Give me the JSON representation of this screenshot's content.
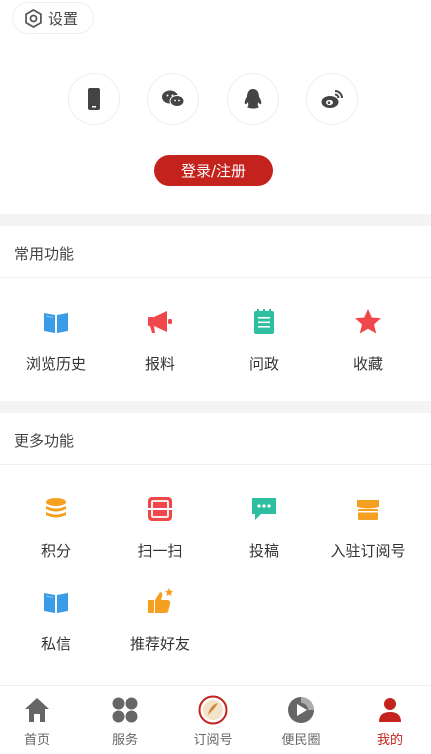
{
  "header": {
    "settings_label": "设置"
  },
  "social_logins": [
    {
      "name": "phone-icon"
    },
    {
      "name": "wechat-icon"
    },
    {
      "name": "qq-icon"
    },
    {
      "name": "weibo-icon"
    }
  ],
  "login_button_label": "登录/注册",
  "common_functions": {
    "title": "常用功能",
    "items": [
      {
        "label": "浏览历史",
        "icon": "book-icon"
      },
      {
        "label": "报料",
        "icon": "megaphone-icon"
      },
      {
        "label": "问政",
        "icon": "notepad-icon"
      },
      {
        "label": "收藏",
        "icon": "star-icon"
      }
    ]
  },
  "more_functions": {
    "title": "更多功能",
    "items": [
      {
        "label": "积分",
        "icon": "coins-icon"
      },
      {
        "label": "扫一扫",
        "icon": "scan-icon"
      },
      {
        "label": "投稿",
        "icon": "chat-bubble-icon"
      },
      {
        "label": "入驻订阅号",
        "icon": "store-icon"
      },
      {
        "label": "私信",
        "icon": "book-icon"
      },
      {
        "label": "推荐好友",
        "icon": "thumbs-up-icon"
      }
    ]
  },
  "tabbar": {
    "tabs": [
      {
        "label": "首页",
        "icon": "home-icon"
      },
      {
        "label": "服务",
        "icon": "grid-icon"
      },
      {
        "label": "订阅号",
        "icon": "subscription-icon"
      },
      {
        "label": "便民圈",
        "icon": "circle-icon"
      },
      {
        "label": "我的",
        "icon": "person-icon"
      }
    ],
    "active_index": 4
  },
  "colors": {
    "accent": "#c4221c",
    "blue": "#3a9be6",
    "red": "#f0484a",
    "teal": "#2ebfa0",
    "orange": "#f5a021",
    "gray_icon": "#666666"
  }
}
